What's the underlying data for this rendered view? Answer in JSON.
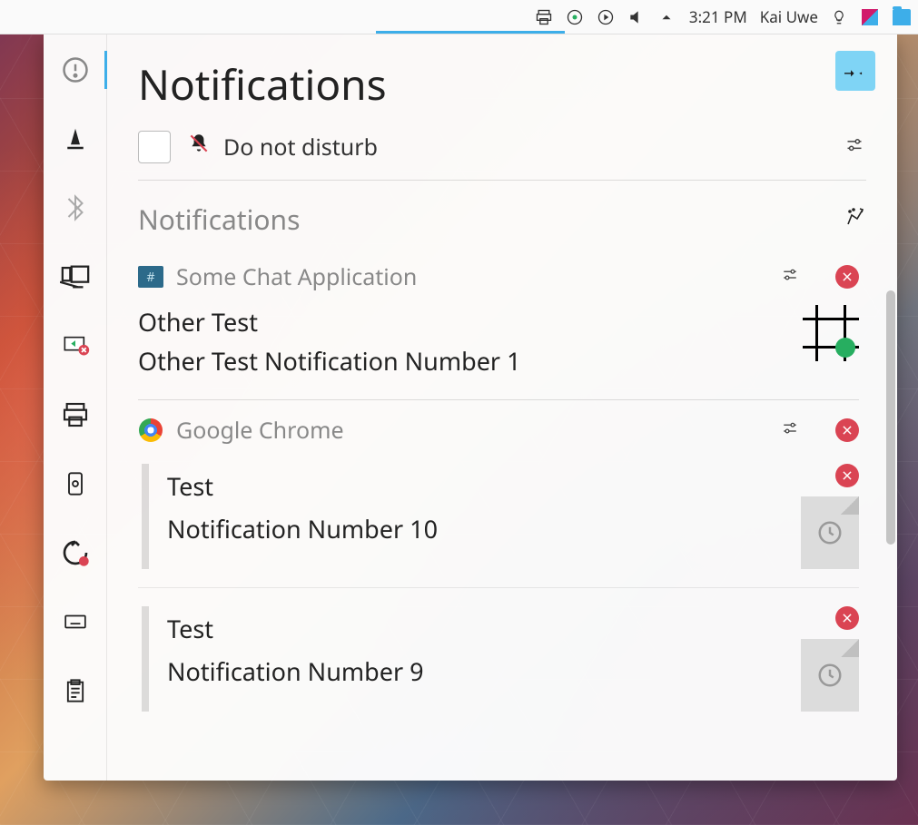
{
  "panel": {
    "clock": "3:21 PM",
    "user": "Kai Uwe"
  },
  "popup": {
    "title": "Notifications",
    "dnd_label": "Do not disturb",
    "section_title": "Notifications",
    "groups": [
      {
        "app": "Some Chat Application",
        "entries": [
          {
            "title": "Other Test",
            "body": "Other Test Notification Number 1"
          }
        ]
      },
      {
        "app": "Google Chrome",
        "entries": [
          {
            "title": "Test",
            "body": "Notification Number 10"
          },
          {
            "title": "Test",
            "body": "Notification Number 9"
          }
        ]
      }
    ]
  },
  "sidebar_items": [
    "notifications",
    "vlc",
    "bluetooth",
    "display",
    "kde-connect",
    "printer",
    "phone",
    "updates",
    "keyboard",
    "clipboard"
  ],
  "colors": {
    "accent": "#3daee9",
    "danger": "#da4453",
    "success": "#27ae60"
  }
}
